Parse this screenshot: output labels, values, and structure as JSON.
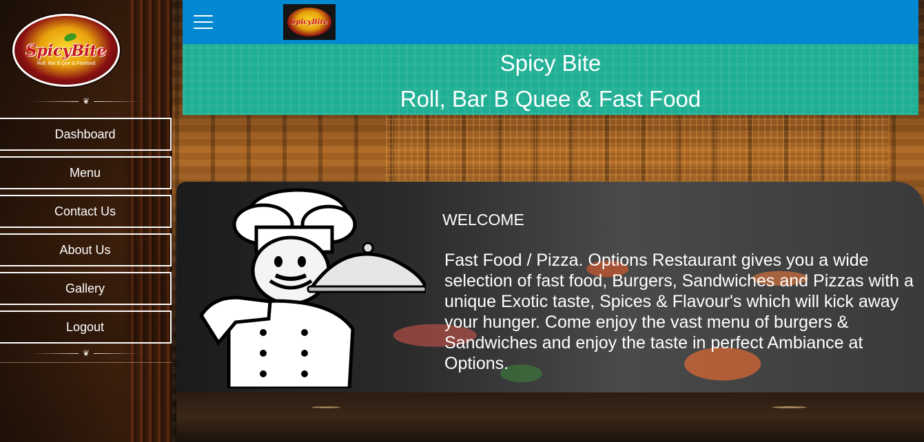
{
  "brand": {
    "logo_word": "SpicyBite",
    "logo_tagline": "Roll, Bar B Que & Fastfood"
  },
  "sidebar": {
    "items": [
      {
        "label": "Dashboard"
      },
      {
        "label": "Menu"
      },
      {
        "label": "Contact Us"
      },
      {
        "label": "About Us"
      },
      {
        "label": "Gallery"
      },
      {
        "label": "Logout"
      }
    ]
  },
  "header": {
    "menu_icon": "hamburger-icon",
    "logo_word": "SpicyBite"
  },
  "banner": {
    "title": "Spicy Bite",
    "subtitle": "Roll, Bar B Quee & Fast Food"
  },
  "main": {
    "welcome_heading": "WELCOME",
    "description": "Fast Food / Pizza. Options Restaurant gives you a wide selection of fast food, Burgers, Sandwiches and Pizzas with a unique Exotic taste, Spices & Flavour's which will kick away your hunger. Come enjoy the vast menu of burgers & Sandwiches and enjoy the taste in perfect Ambiance at Options."
  },
  "colors": {
    "topbar": "#0288d1",
    "banner": "#1faf94",
    "nav_border": "#ffffff"
  }
}
